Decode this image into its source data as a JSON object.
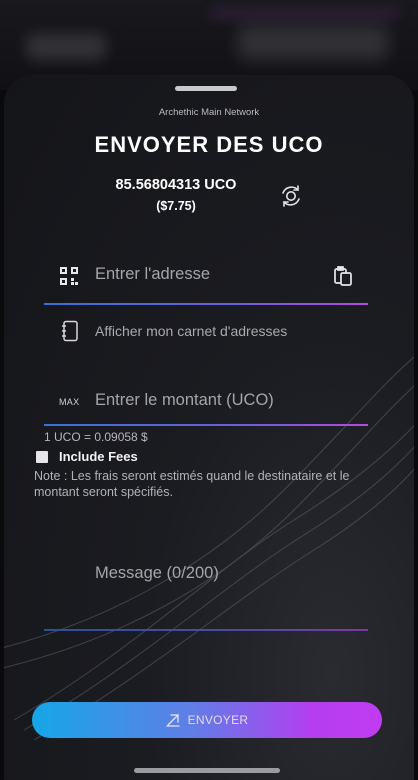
{
  "network": "Archethic Main Network",
  "title": "ENVOYER DES UCO",
  "balance": {
    "amount": "85.56804313 UCO",
    "fiat": "($7.75)"
  },
  "address": {
    "placeholder": "Entrer l'adresse",
    "qr_icon": "qr-code-icon",
    "paste_icon": "paste-icon"
  },
  "address_book": {
    "label": "Afficher mon carnet d'adresses",
    "icon": "address-book-icon"
  },
  "amount": {
    "max_label": "MAX",
    "placeholder": "Entrer le montant (UCO)",
    "rate": "1 UCO = 0.09058 $"
  },
  "fees": {
    "label": "Include Fees",
    "checked": false,
    "note": "Note : Les frais seront estimés quand le destinataire et le montant seront spécifiés."
  },
  "message": {
    "placeholder": "Message (0/200)"
  },
  "send_button": {
    "label": "ENVOYER",
    "icon": "send-arrow-icon"
  },
  "colors": {
    "accent_start": "#16a6e8",
    "accent_end": "#c13cf2",
    "sheet_background": "#1b1c21"
  }
}
